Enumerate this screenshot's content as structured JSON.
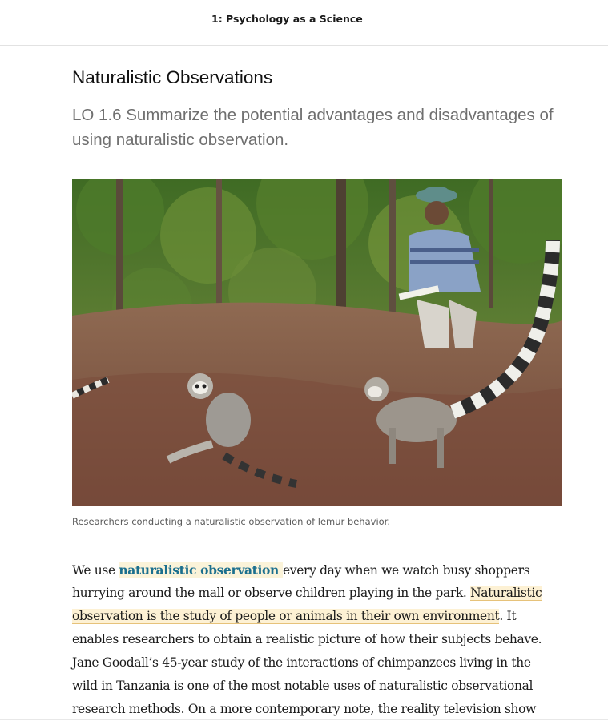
{
  "header": {
    "chapter_title": "1: Psychology as a Science"
  },
  "section": {
    "heading": "Naturalistic Observations",
    "learning_objective": "LO 1.6 Summarize the potential advantages and disadvantages of using naturalistic observation."
  },
  "figure": {
    "caption": "Researchers conducting a naturalistic observation of lemur behavior."
  },
  "paragraph": {
    "l1_a": "We use ",
    "l1_term": "naturalistic observation ",
    "l1_b": "every day when we watch busy shoppers",
    "l2_a": "hurrying around the mall or observe children playing in the park. ",
    "l2_hl": "Naturalistic",
    "l3_hl": "observation is the study of people or animals in their own environment",
    "l3_b": ". It",
    "l4": "enables researchers to obtain a realistic picture of how their subjects behave.",
    "l5": "Jane Goodall’s 45-year study of the interactions of chimpanzees living in the",
    "l6": "wild in Tanzania is one of the most notable uses of naturalistic observational",
    "l7": "research methods. On a more contemporary note, the reality television show"
  },
  "colors": {
    "term_link": "#1b6f8e",
    "highlight": "#fdf1d4",
    "muted_heading": "#6f6f6f"
  }
}
